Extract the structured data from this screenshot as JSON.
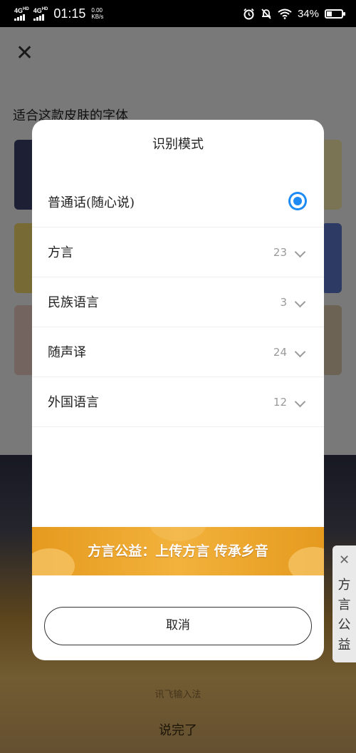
{
  "status_bar": {
    "signal1": "4G",
    "signal1_sup": "HD",
    "signal2": "4G",
    "signal2_sup": "HD",
    "time": "01:15",
    "speed_value": "0.00",
    "speed_unit": "KB/s",
    "battery": "34%",
    "battery_level": 0.34
  },
  "background": {
    "close_icon": "close-icon",
    "heading": "适合这款皮肤的字体",
    "ime_name": "讯飞输入法",
    "voice_done": "说完了"
  },
  "dialog": {
    "title": "识别模式",
    "options": [
      {
        "label": "普通话(随心说)",
        "selected": true
      },
      {
        "label": "方言",
        "count": "23"
      },
      {
        "label": "民族语言",
        "count": "3"
      },
      {
        "label": "随声译",
        "count": "24"
      },
      {
        "label": "外国语言",
        "count": "12"
      }
    ],
    "banner": "方言公益：上传方言 传承乡音",
    "cancel": "取消"
  },
  "side_tab": {
    "close": "✕",
    "text": [
      "方",
      "言",
      "公",
      "益"
    ]
  },
  "colors": {
    "accent": "#1e8bf5",
    "banner": "#f0a82c"
  }
}
